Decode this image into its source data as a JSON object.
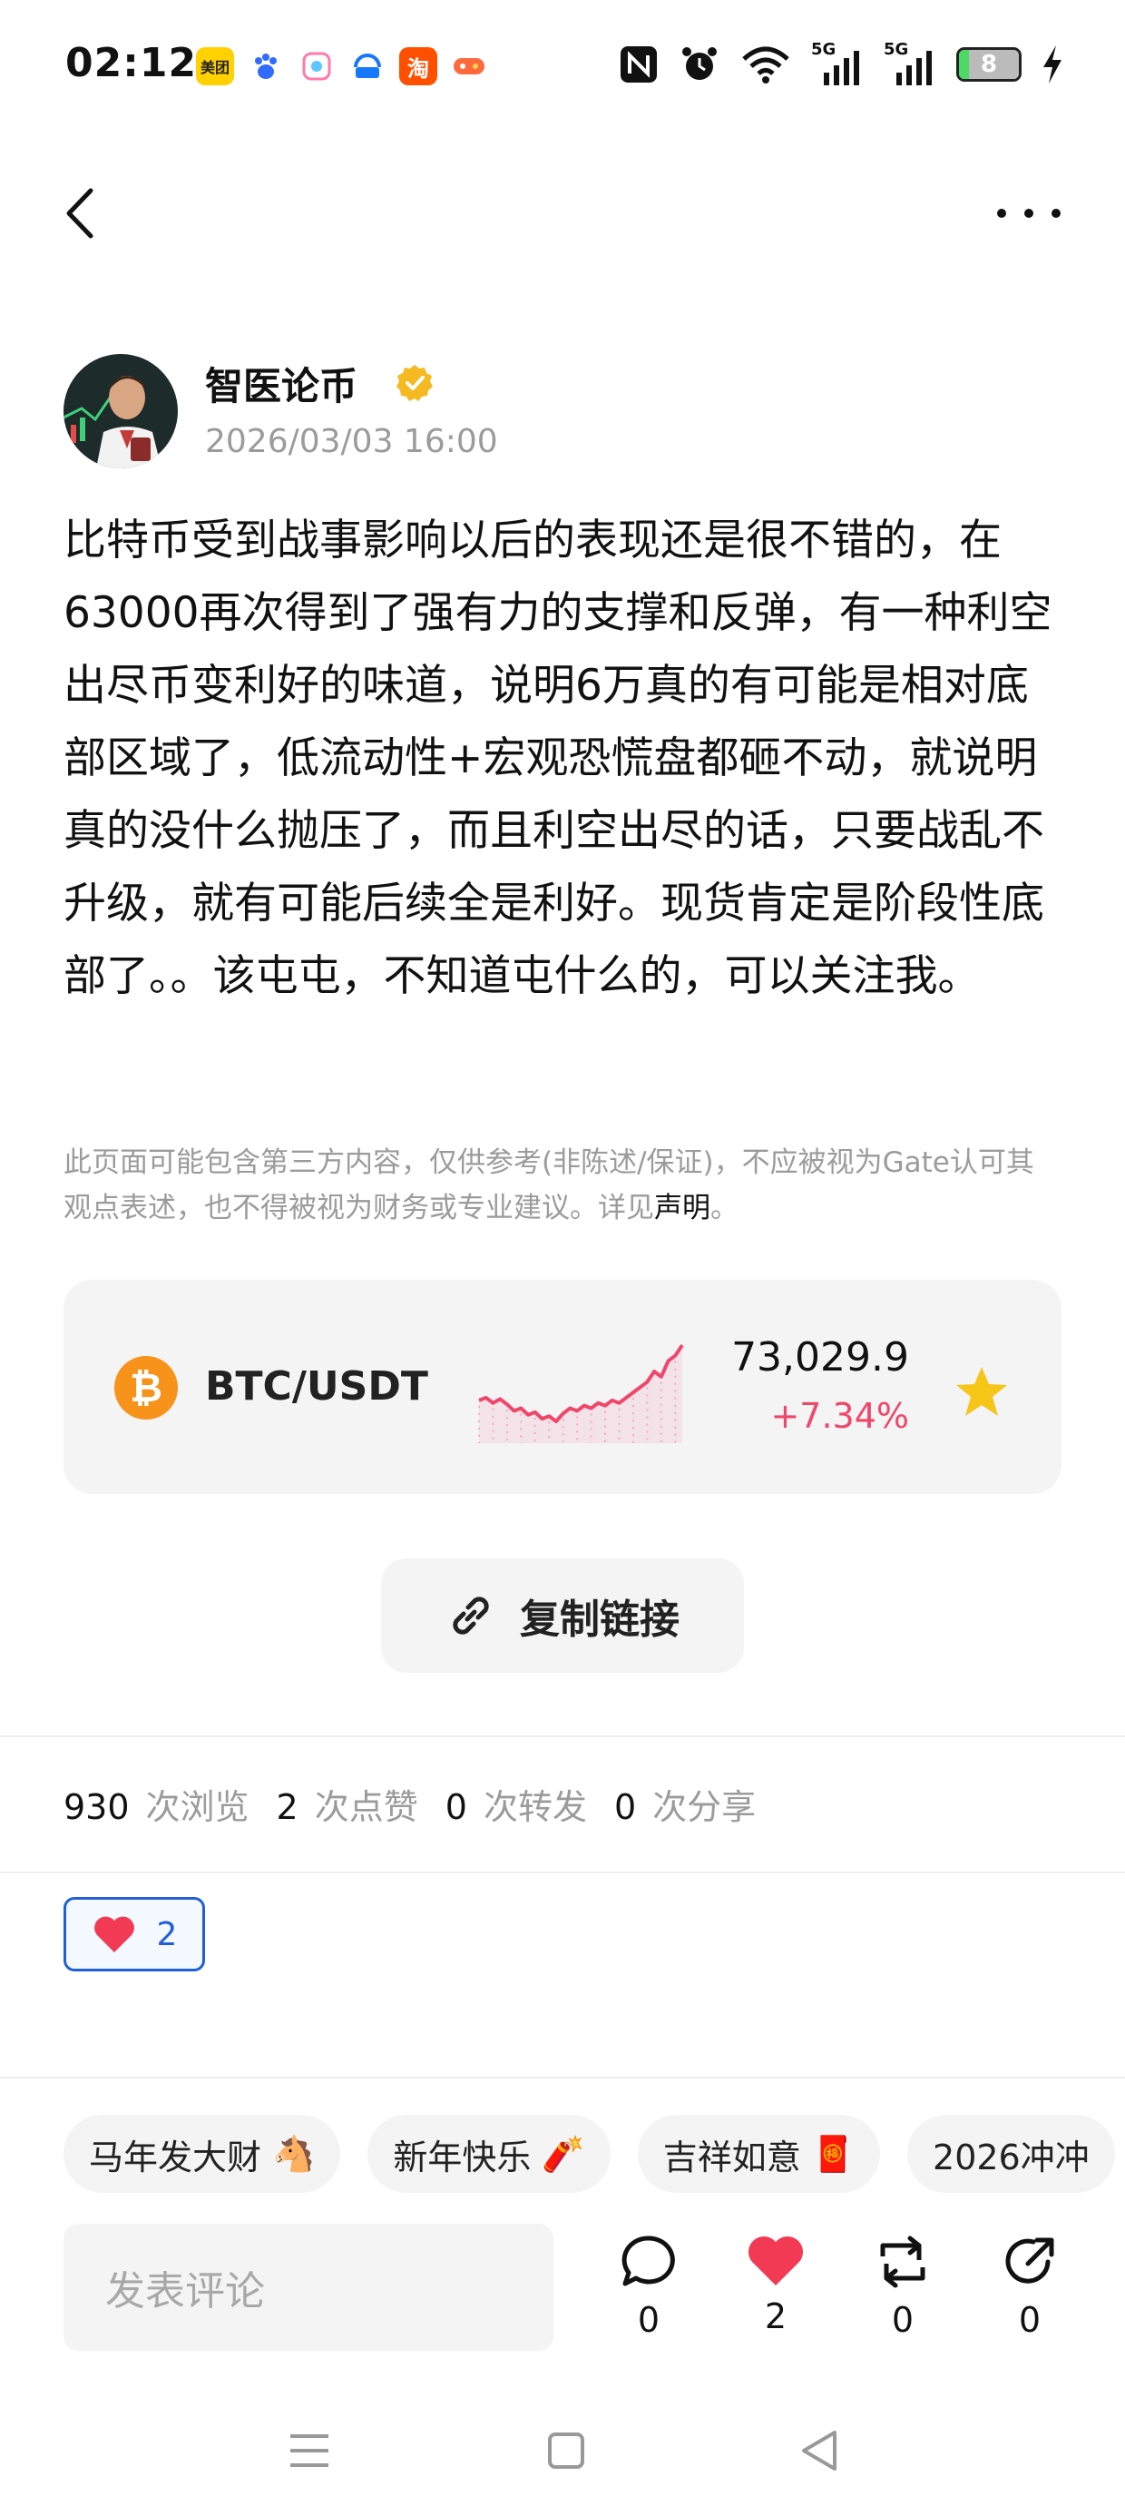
{
  "status_bar": {
    "time": "02:12",
    "notifications": [
      {
        "icon": "meituan-icon",
        "label": "美团",
        "color": "#ffd100"
      },
      {
        "icon": "baidu-icon",
        "label": "",
        "color": "#2f6bff"
      },
      {
        "icon": "app-icon",
        "label": "",
        "color": "#ff7aa8"
      },
      {
        "icon": "alipay-icon",
        "label": "",
        "color": "#1677ff"
      },
      {
        "icon": "taobao-icon",
        "label": "淘",
        "color": "#ff5000"
      },
      {
        "icon": "game-icon",
        "label": "",
        "color": "#ff6a3d"
      }
    ],
    "signal_label_1": "5G",
    "signal_label_2": "5G",
    "battery_level": "8"
  },
  "author": {
    "name": "智医论币",
    "time": "2026/03/03 16:00"
  },
  "post": {
    "body": "比特币受到战事影响以后的表现还是很不错的，在63000再次得到了强有力的支撑和反弹，有一种利空出尽币变利好的味道，说明6万真的有可能是相对底部区域了，低流动性+宏观恐慌盘都砸不动，就说明真的没什么抛压了，而且利空出尽的话，只要战乱不升级，就有可能后续全是利好。现货肯定是阶段性底部了。。该屯屯，不知道屯什么的，可以关注我。",
    "disclaimer": "此页面可能包含第三方内容，仅供参考(非陈述/保证)，不应被视为Gate认可其观点表述，也不得被视为财务或专业建议。详见",
    "disclaimer_link": "声明",
    "disclaimer_end": "。"
  },
  "ticker": {
    "symbol_glyph": "₿",
    "pair": "BTC/USDT",
    "price": "73,029.9",
    "change": "+7.34%",
    "change_color": "#f0466a",
    "sparkline": [
      52,
      50,
      54,
      51,
      55,
      60,
      58,
      63,
      61,
      66,
      64,
      68,
      62,
      58,
      60,
      56,
      58,
      54,
      56,
      52,
      54,
      50,
      46,
      42,
      38,
      30,
      34,
      22,
      18,
      10
    ]
  },
  "copy_link_label": "复制链接",
  "stats": [
    {
      "num": "930",
      "label": "次浏览"
    },
    {
      "num": "2",
      "label": "次点赞"
    },
    {
      "num": "0",
      "label": "次转发"
    },
    {
      "num": "0",
      "label": "次分享"
    }
  ],
  "reaction": {
    "emoji": "❤️",
    "count": "2"
  },
  "tags": [
    {
      "text": "马年发大财",
      "emoji": "🐴"
    },
    {
      "text": "新年快乐",
      "emoji": "🧨"
    },
    {
      "text": "吉祥如意",
      "emoji": "🧧"
    },
    {
      "text": "2026冲冲",
      "emoji": ""
    }
  ],
  "comment": {
    "placeholder": "发表评论"
  },
  "actions": {
    "comment_count": "0",
    "like_count": "2",
    "repost_count": "0",
    "share_count": "0"
  }
}
